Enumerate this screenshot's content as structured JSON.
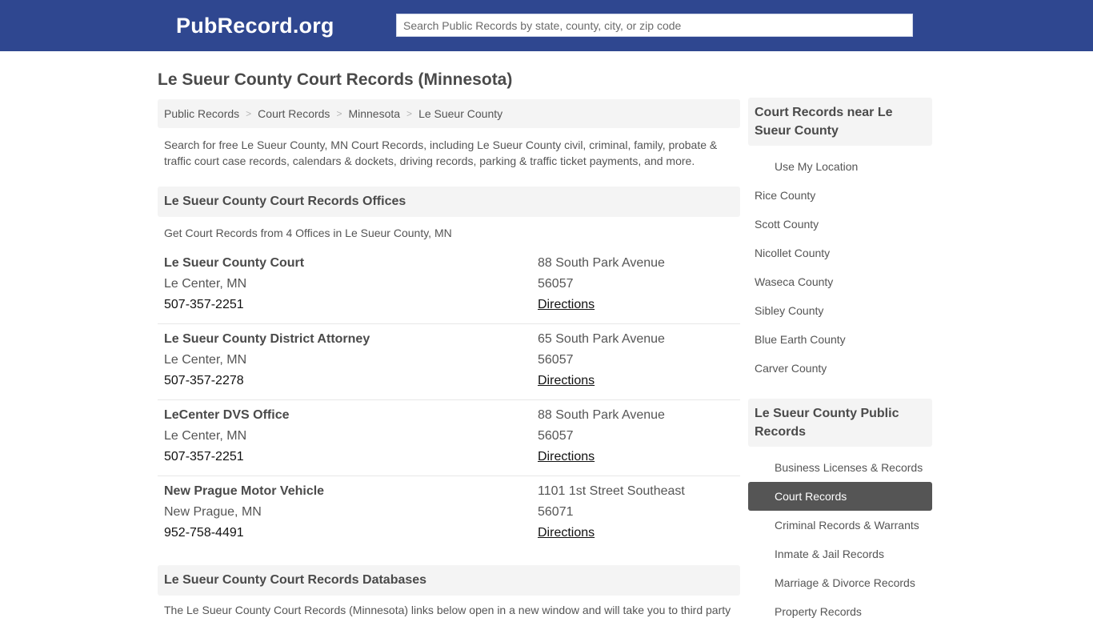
{
  "header": {
    "logo": "PubRecord.org",
    "search_placeholder": "Search Public Records by state, county, city, or zip code"
  },
  "page": {
    "title": "Le Sueur County Court Records (Minnesota)"
  },
  "breadcrumb": [
    {
      "label": "Public Records"
    },
    {
      "label": "Court Records"
    },
    {
      "label": "Minnesota"
    },
    {
      "label": "Le Sueur County"
    }
  ],
  "breadcrumb_separator": ">",
  "intro": "Search for free Le Sueur County, MN Court Records, including Le Sueur County civil, criminal, family, probate & traffic court case records, calendars & dockets, driving records, parking & traffic ticket payments, and more.",
  "offices_section": {
    "heading": "Le Sueur County Court Records Offices",
    "subtext": "Get Court Records from 4 Offices in Le Sueur County, MN",
    "directions_label": "Directions",
    "offices": [
      {
        "name": "Le Sueur County Court",
        "city": "Le Center, MN",
        "phone": "507-357-2251",
        "address": "88 South Park Avenue",
        "zip": "56057"
      },
      {
        "name": "Le Sueur County District Attorney",
        "city": "Le Center, MN",
        "phone": "507-357-2278",
        "address": "65 South Park Avenue",
        "zip": "56057"
      },
      {
        "name": "LeCenter DVS Office",
        "city": "Le Center, MN",
        "phone": "507-357-2251",
        "address": "88 South Park Avenue",
        "zip": "56057"
      },
      {
        "name": "New Prague Motor Vehicle",
        "city": "New Prague, MN",
        "phone": "952-758-4491",
        "address": "1101 1st Street Southeast",
        "zip": "56071"
      }
    ]
  },
  "databases_section": {
    "heading": "Le Sueur County Court Records Databases",
    "text": "The Le Sueur County Court Records (Minnesota) links below open in a new window and will take you to third party"
  },
  "sidebar": {
    "nearby": {
      "heading": "Court Records near Le Sueur County",
      "use_location": "Use My Location",
      "counties": [
        "Rice County",
        "Scott County",
        "Nicollet County",
        "Waseca County",
        "Sibley County",
        "Blue Earth County",
        "Carver County"
      ]
    },
    "public_records": {
      "heading": "Le Sueur County Public Records",
      "items": [
        {
          "label": "Business Licenses & Records",
          "active": false
        },
        {
          "label": "Court Records",
          "active": true
        },
        {
          "label": "Criminal Records & Warrants",
          "active": false
        },
        {
          "label": "Inmate & Jail Records",
          "active": false
        },
        {
          "label": "Marriage & Divorce Records",
          "active": false
        },
        {
          "label": "Property Records",
          "active": false
        }
      ]
    }
  },
  "colors": {
    "header_bg": "#2f4790",
    "panel_bg": "#f4f4f4",
    "active_item_bg": "#555555"
  }
}
